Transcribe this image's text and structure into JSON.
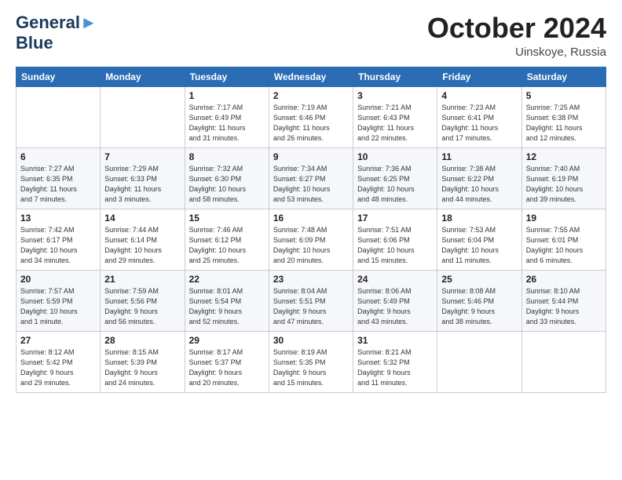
{
  "header": {
    "logo_line1": "General",
    "logo_line2": "Blue",
    "month_title": "October 2024",
    "location": "Uinskoye, Russia"
  },
  "days_of_week": [
    "Sunday",
    "Monday",
    "Tuesday",
    "Wednesday",
    "Thursday",
    "Friday",
    "Saturday"
  ],
  "weeks": [
    [
      {
        "day": "",
        "info": ""
      },
      {
        "day": "",
        "info": ""
      },
      {
        "day": "1",
        "info": "Sunrise: 7:17 AM\nSunset: 6:49 PM\nDaylight: 11 hours\nand 31 minutes."
      },
      {
        "day": "2",
        "info": "Sunrise: 7:19 AM\nSunset: 6:46 PM\nDaylight: 11 hours\nand 26 minutes."
      },
      {
        "day": "3",
        "info": "Sunrise: 7:21 AM\nSunset: 6:43 PM\nDaylight: 11 hours\nand 22 minutes."
      },
      {
        "day": "4",
        "info": "Sunrise: 7:23 AM\nSunset: 6:41 PM\nDaylight: 11 hours\nand 17 minutes."
      },
      {
        "day": "5",
        "info": "Sunrise: 7:25 AM\nSunset: 6:38 PM\nDaylight: 11 hours\nand 12 minutes."
      }
    ],
    [
      {
        "day": "6",
        "info": "Sunrise: 7:27 AM\nSunset: 6:35 PM\nDaylight: 11 hours\nand 7 minutes."
      },
      {
        "day": "7",
        "info": "Sunrise: 7:29 AM\nSunset: 6:33 PM\nDaylight: 11 hours\nand 3 minutes."
      },
      {
        "day": "8",
        "info": "Sunrise: 7:32 AM\nSunset: 6:30 PM\nDaylight: 10 hours\nand 58 minutes."
      },
      {
        "day": "9",
        "info": "Sunrise: 7:34 AM\nSunset: 6:27 PM\nDaylight: 10 hours\nand 53 minutes."
      },
      {
        "day": "10",
        "info": "Sunrise: 7:36 AM\nSunset: 6:25 PM\nDaylight: 10 hours\nand 48 minutes."
      },
      {
        "day": "11",
        "info": "Sunrise: 7:38 AM\nSunset: 6:22 PM\nDaylight: 10 hours\nand 44 minutes."
      },
      {
        "day": "12",
        "info": "Sunrise: 7:40 AM\nSunset: 6:19 PM\nDaylight: 10 hours\nand 39 minutes."
      }
    ],
    [
      {
        "day": "13",
        "info": "Sunrise: 7:42 AM\nSunset: 6:17 PM\nDaylight: 10 hours\nand 34 minutes."
      },
      {
        "day": "14",
        "info": "Sunrise: 7:44 AM\nSunset: 6:14 PM\nDaylight: 10 hours\nand 29 minutes."
      },
      {
        "day": "15",
        "info": "Sunrise: 7:46 AM\nSunset: 6:12 PM\nDaylight: 10 hours\nand 25 minutes."
      },
      {
        "day": "16",
        "info": "Sunrise: 7:48 AM\nSunset: 6:09 PM\nDaylight: 10 hours\nand 20 minutes."
      },
      {
        "day": "17",
        "info": "Sunrise: 7:51 AM\nSunset: 6:06 PM\nDaylight: 10 hours\nand 15 minutes."
      },
      {
        "day": "18",
        "info": "Sunrise: 7:53 AM\nSunset: 6:04 PM\nDaylight: 10 hours\nand 11 minutes."
      },
      {
        "day": "19",
        "info": "Sunrise: 7:55 AM\nSunset: 6:01 PM\nDaylight: 10 hours\nand 6 minutes."
      }
    ],
    [
      {
        "day": "20",
        "info": "Sunrise: 7:57 AM\nSunset: 5:59 PM\nDaylight: 10 hours\nand 1 minute."
      },
      {
        "day": "21",
        "info": "Sunrise: 7:59 AM\nSunset: 5:56 PM\nDaylight: 9 hours\nand 56 minutes."
      },
      {
        "day": "22",
        "info": "Sunrise: 8:01 AM\nSunset: 5:54 PM\nDaylight: 9 hours\nand 52 minutes."
      },
      {
        "day": "23",
        "info": "Sunrise: 8:04 AM\nSunset: 5:51 PM\nDaylight: 9 hours\nand 47 minutes."
      },
      {
        "day": "24",
        "info": "Sunrise: 8:06 AM\nSunset: 5:49 PM\nDaylight: 9 hours\nand 43 minutes."
      },
      {
        "day": "25",
        "info": "Sunrise: 8:08 AM\nSunset: 5:46 PM\nDaylight: 9 hours\nand 38 minutes."
      },
      {
        "day": "26",
        "info": "Sunrise: 8:10 AM\nSunset: 5:44 PM\nDaylight: 9 hours\nand 33 minutes."
      }
    ],
    [
      {
        "day": "27",
        "info": "Sunrise: 8:12 AM\nSunset: 5:42 PM\nDaylight: 9 hours\nand 29 minutes."
      },
      {
        "day": "28",
        "info": "Sunrise: 8:15 AM\nSunset: 5:39 PM\nDaylight: 9 hours\nand 24 minutes."
      },
      {
        "day": "29",
        "info": "Sunrise: 8:17 AM\nSunset: 5:37 PM\nDaylight: 9 hours\nand 20 minutes."
      },
      {
        "day": "30",
        "info": "Sunrise: 8:19 AM\nSunset: 5:35 PM\nDaylight: 9 hours\nand 15 minutes."
      },
      {
        "day": "31",
        "info": "Sunrise: 8:21 AM\nSunset: 5:32 PM\nDaylight: 9 hours\nand 11 minutes."
      },
      {
        "day": "",
        "info": ""
      },
      {
        "day": "",
        "info": ""
      }
    ]
  ]
}
